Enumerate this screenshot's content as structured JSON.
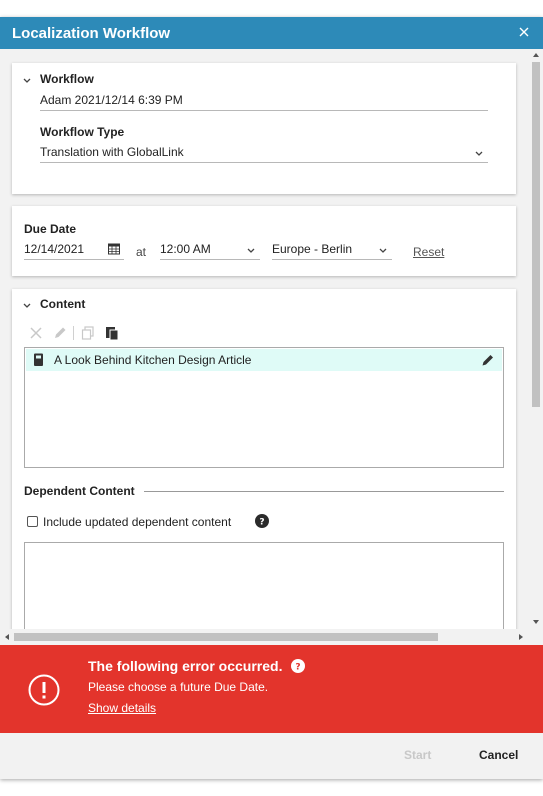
{
  "dialog": {
    "title": "Localization Workflow",
    "close_icon": "close-icon"
  },
  "workflow": {
    "section_title": "Workflow",
    "name_value": "Adam 2021/12/14 6:39 PM",
    "type_label": "Workflow Type",
    "type_value": "Translation with GlobalLink"
  },
  "due_date": {
    "label": "Due Date",
    "date_value": "12/14/2021",
    "at_label": "at",
    "time_value": "12:00 AM",
    "timezone_value": "Europe - Berlin",
    "reset_label": "Reset"
  },
  "content": {
    "section_title": "Content",
    "toolbar_icons": [
      "remove-icon",
      "edit-icon",
      "copy-icon",
      "paste-icon"
    ],
    "items": [
      {
        "label": "A Look Behind Kitchen Design Article",
        "icon": "article-icon"
      }
    ],
    "dependent_title": "Dependent Content",
    "include_dependent_label": "Include updated dependent content",
    "include_dependent_checked": false
  },
  "error": {
    "heading": "The following error occurred.",
    "message": "Please choose a future Due Date.",
    "details_link": "Show details"
  },
  "footer": {
    "start_label": "Start",
    "cancel_label": "Cancel"
  },
  "colors": {
    "titlebar": "#2d8ab8",
    "error": "#e3342c",
    "selected_row": "#dffbf7"
  }
}
